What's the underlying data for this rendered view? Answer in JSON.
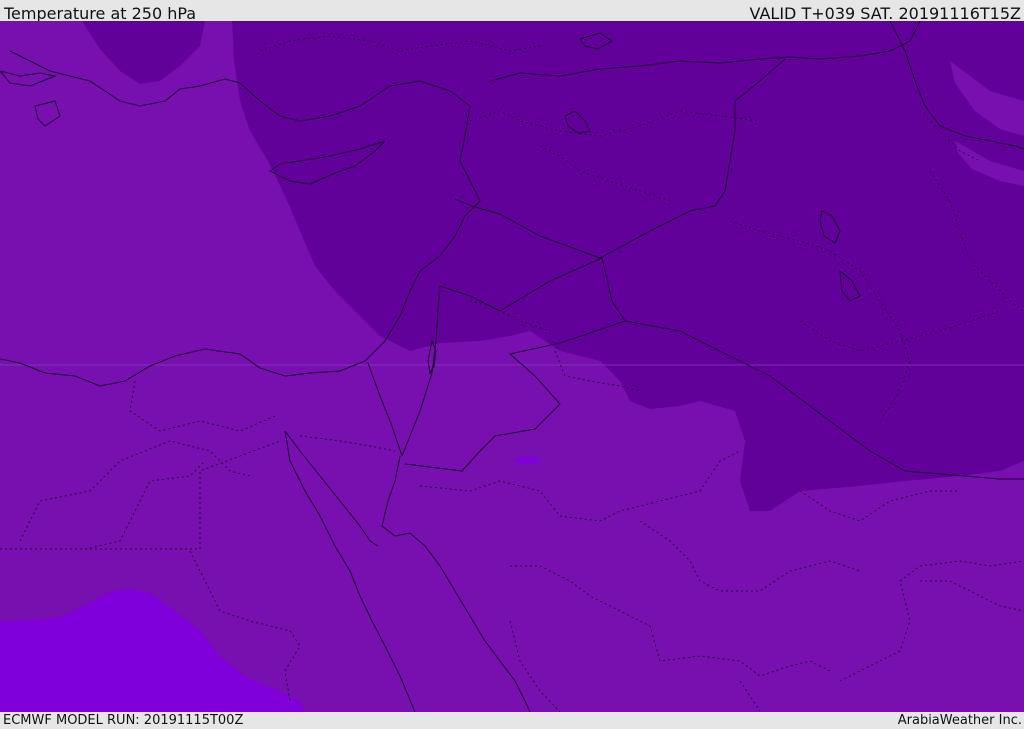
{
  "header": {
    "title": "Temperature at 250 hPa",
    "valid": "VALID T+039 SAT. 20191116T15Z"
  },
  "footer": {
    "model_run": "ECMWF MODEL RUN: 20191115T00Z",
    "credit": "ArabiaWeather Inc."
  },
  "map": {
    "field": "temperature",
    "level": "250 hPa",
    "colors": {
      "base": "#7810b0",
      "cold": "#62009a",
      "warm": "#8000dc",
      "line": "#1a0030"
    }
  }
}
